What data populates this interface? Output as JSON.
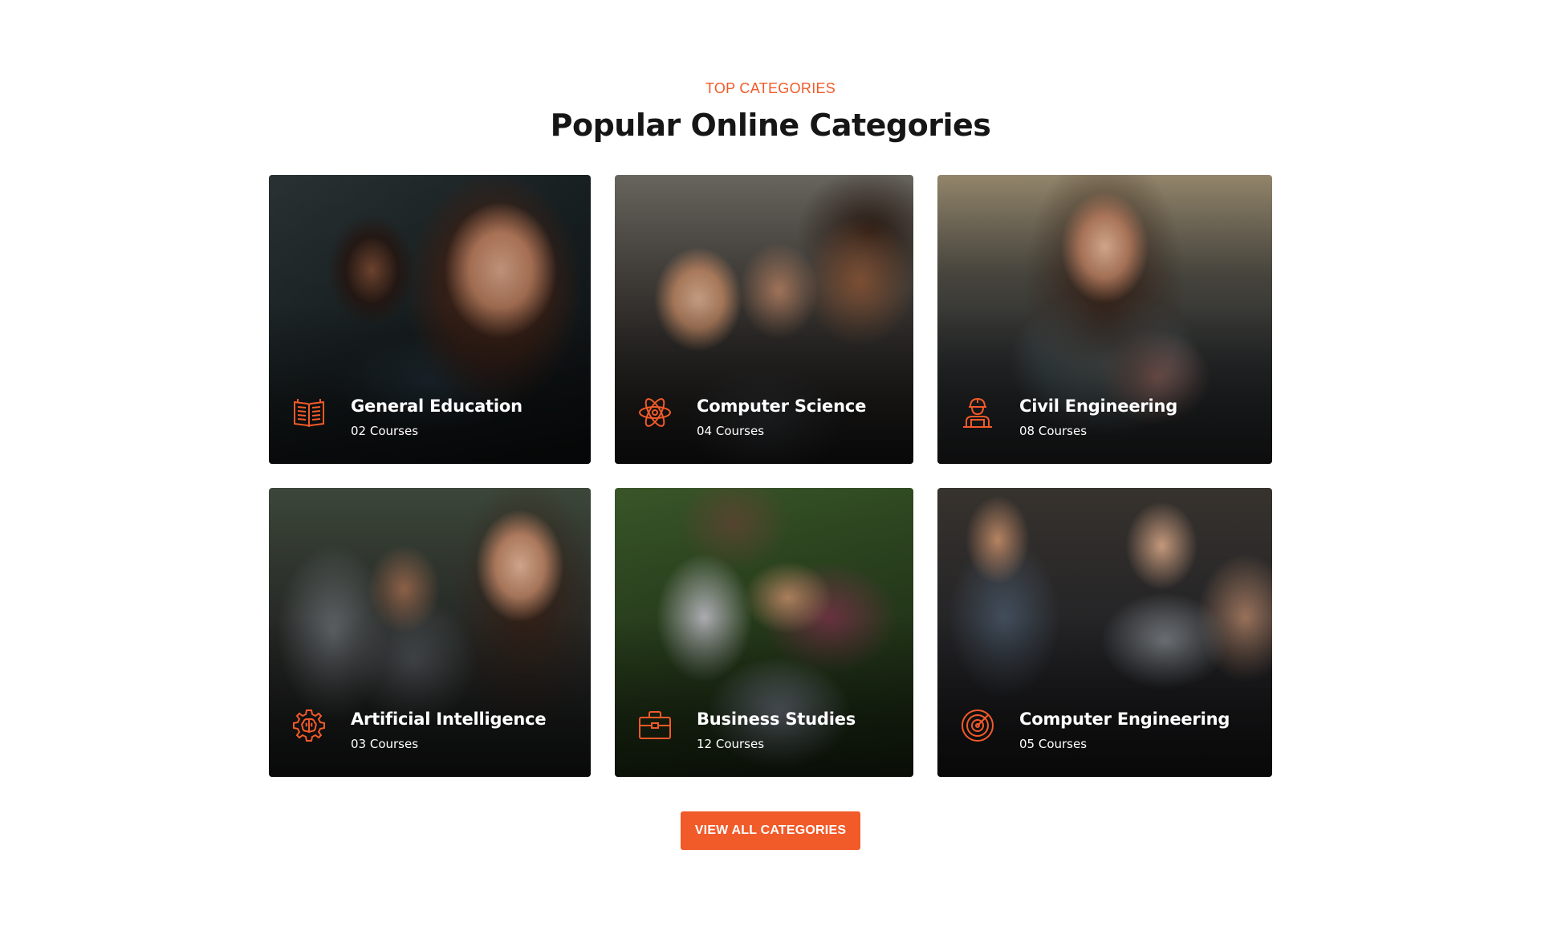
{
  "section": {
    "eyebrow": "TOP CATEGORIES",
    "title": "Popular Online Categories"
  },
  "categories": [
    {
      "name": "General Education",
      "count": "02 Courses",
      "icon": "open-book-icon"
    },
    {
      "name": "Computer Science",
      "count": "04 Courses",
      "icon": "atom-icon"
    },
    {
      "name": "Civil Engineering",
      "count": "08 Courses",
      "icon": "engineer-icon"
    },
    {
      "name": "Artificial Intelligence",
      "count": "03 Courses",
      "icon": "brain-gear-icon"
    },
    {
      "name": "Business Studies",
      "count": "12 Courses",
      "icon": "briefcase-icon"
    },
    {
      "name": "Computer Engineering",
      "count": "05 Courses",
      "icon": "target-icon"
    }
  ],
  "cta": {
    "label": "VIEW ALL CATEGORIES"
  },
  "colors": {
    "accent": "#f15a29",
    "heading": "#161616",
    "card_text": "#ffffff"
  }
}
